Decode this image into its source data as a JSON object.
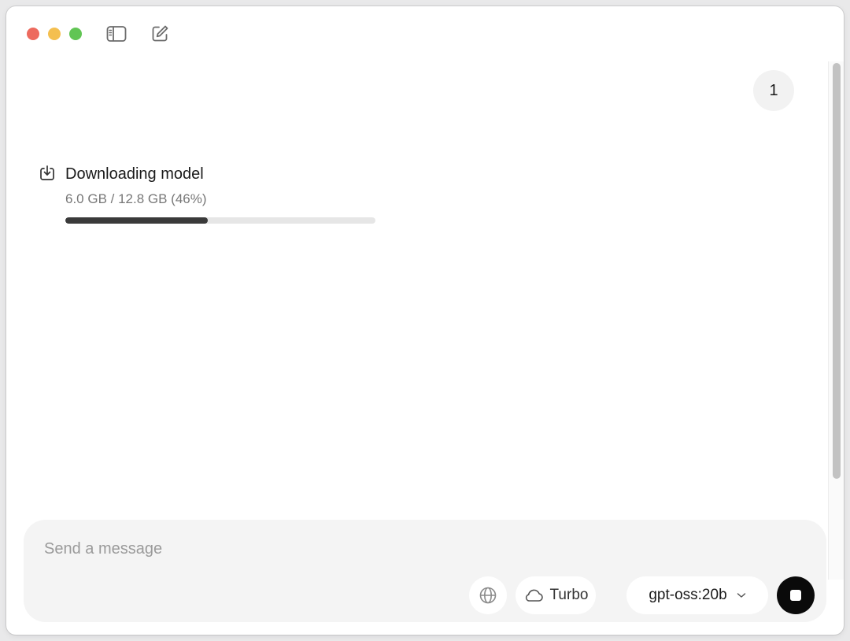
{
  "chat": {
    "user_message": "1",
    "download": {
      "title": "Downloading model",
      "progress_text": "6.0 GB / 12.8 GB (46%)",
      "progress_fraction": 0.46
    }
  },
  "composer": {
    "placeholder": "Send a message",
    "turbo_label": "Turbo",
    "model_label": "gpt-oss:20b"
  },
  "icons": {
    "sidebar_toggle": "sidebar-icon",
    "new_chat": "compose-icon",
    "download": "download-icon",
    "web_search": "globe-icon",
    "turbo": "cloud-icon",
    "model_dropdown": "chevron-down-icon",
    "stop": "stop-icon"
  },
  "colors": {
    "close": "#ed6a5e",
    "minimize": "#f4bf4f",
    "maximize": "#61c554",
    "progress_fill": "#3a3a3a",
    "stop_button": "#0a0a0a"
  }
}
